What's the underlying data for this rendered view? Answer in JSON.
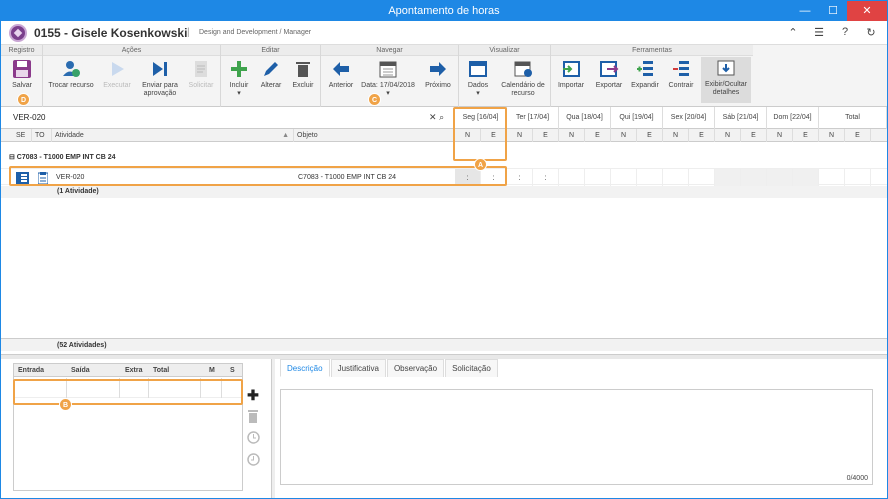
{
  "window": {
    "title": "Apontamento de horas",
    "min": "—",
    "max": "☐",
    "close": "✕"
  },
  "user": {
    "name": "0155 - Gisele Kosenkowski",
    "sep": "|",
    "role": "Design and Development / Manager"
  },
  "ribbon": {
    "groups": {
      "registro": "Registro",
      "acoes": "Ações",
      "editar": "Editar",
      "navegar": "Navegar",
      "visualizar": "Visualizar",
      "ferramentas": "Ferramentas"
    },
    "salvar": "Salvar",
    "trocar": "Trocar recurso",
    "executar": "Executar",
    "enviar": "Enviar para aprovação",
    "solicitar": "Solicitar",
    "incluir": "Incluir",
    "alterar": "Alterar",
    "excluir": "Excluir",
    "anterior": "Anterior",
    "data": "Data: 17/04/2018",
    "proximo": "Próximo",
    "dados": "Dados",
    "calendario": "Calendário de recurso",
    "importar": "Importar",
    "exportar": "Exportar",
    "expandir": "Expandir",
    "contrair": "Contrair",
    "exibir": "Exibir/Ocultar detalhes",
    "drop": "▾"
  },
  "search": {
    "value": "VER-020",
    "clear": "✕",
    "go": "⌕"
  },
  "grid": {
    "cols": {
      "se": "SE",
      "to": "TO",
      "atividade": "Atividade",
      "sort": "▲",
      "objeto": "Objeto"
    },
    "days": [
      "Seg [16/04]",
      "Ter [17/04]",
      "Qua [18/04]",
      "Qui [19/04]",
      "Sex [20/04]",
      "Sáb [21/04]",
      "Dom [22/04]",
      "Total"
    ],
    "n": "N",
    "e": "E",
    "group": "⊟ C7083 - T1000 EMP INT CB 24",
    "row": {
      "atividade": "VER-020",
      "objeto": "C7083 - T1000 EMP INT CB 24",
      "t1": ":",
      "t2": ":",
      "t3": ":",
      "t4": ":"
    },
    "sum": "(1 Atividade)",
    "footer": "(52 Atividades)"
  },
  "lower": {
    "cols": [
      "Entrada",
      "Saída",
      "Extra",
      "Total",
      "M",
      "S"
    ],
    "add": "✚",
    "tabs": [
      "Descrição",
      "Justificativa",
      "Observação",
      "Solicitação"
    ],
    "counter": "0/4000"
  },
  "badges": {
    "a": "A",
    "b": "B",
    "c": "C",
    "d": "D"
  }
}
